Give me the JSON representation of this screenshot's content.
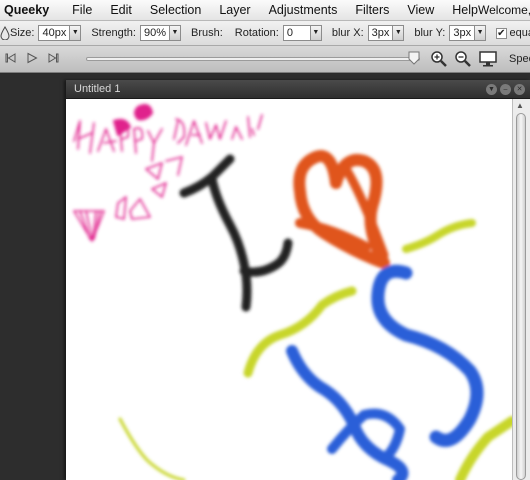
{
  "menubar": {
    "app_name": "Queeky",
    "items": [
      "File",
      "Edit",
      "Selection",
      "Layer",
      "Adjustments",
      "Filters",
      "View",
      "Help"
    ],
    "welcome": "Welcome, C"
  },
  "options": {
    "size_label": "Size:",
    "size_value": "40px",
    "strength_label": "Strength:",
    "strength_value": "90%",
    "brush_label": "Brush:",
    "rotation_label": "Rotation:",
    "rotation_value": "0",
    "blurx_label": "blur X:",
    "blurx_value": "3px",
    "blury_label": "blur Y:",
    "blury_value": "3px",
    "equal_label": "equal"
  },
  "playback": {
    "speed_label": "Spee"
  },
  "document": {
    "title": "Untitled 1"
  },
  "colors": {
    "pink": "#e0208c",
    "orange": "#e0541e",
    "black": "#222222",
    "yellow": "#c8d62c",
    "blue": "#2a5fd8"
  }
}
